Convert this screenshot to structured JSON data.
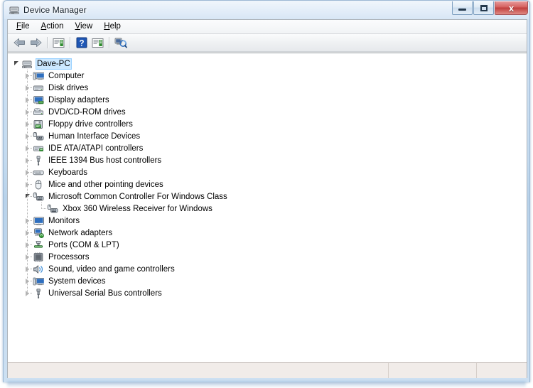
{
  "window": {
    "title": "Device Manager",
    "icon": "device-manager-icon",
    "caption_buttons": {
      "minimize": "minimize-button",
      "maximize": "maximize-button",
      "close_label": "x"
    }
  },
  "menubar": {
    "items": [
      {
        "label": "File",
        "accel": "F",
        "name": "menu-file"
      },
      {
        "label": "Action",
        "accel": "A",
        "name": "menu-action"
      },
      {
        "label": "View",
        "accel": "V",
        "name": "menu-view"
      },
      {
        "label": "Help",
        "accel": "H",
        "name": "menu-help"
      }
    ]
  },
  "toolbar": {
    "buttons": [
      {
        "name": "back-button",
        "icon": "back-arrow-icon",
        "tooltip": "Back"
      },
      {
        "name": "forward-button",
        "icon": "forward-arrow-icon",
        "tooltip": "Forward"
      },
      {
        "name": "separator-1",
        "icon": "separator",
        "tooltip": ""
      },
      {
        "name": "properties-button",
        "icon": "properties-icon",
        "tooltip": "Properties"
      },
      {
        "name": "separator-2",
        "icon": "separator",
        "tooltip": ""
      },
      {
        "name": "help-button",
        "icon": "help-question-icon",
        "tooltip": "Help"
      },
      {
        "name": "show-hidden-button",
        "icon": "show-hidden-devices-icon",
        "tooltip": "Show hidden devices"
      },
      {
        "name": "separator-3",
        "icon": "separator",
        "tooltip": ""
      },
      {
        "name": "scan-hardware-button",
        "icon": "scan-hardware-changes-icon",
        "tooltip": "Scan for hardware changes"
      }
    ]
  },
  "tree": {
    "root": {
      "label": "Dave-PC",
      "icon": "computer-tower-icon",
      "selected": true,
      "expanded": true
    },
    "nodes": [
      {
        "label": "Computer",
        "icon": "computer-icon",
        "expanded": false,
        "level": 1
      },
      {
        "label": "Disk drives",
        "icon": "disk-drive-icon",
        "expanded": false,
        "level": 1
      },
      {
        "label": "Display adapters",
        "icon": "display-adapter-icon",
        "expanded": false,
        "level": 1
      },
      {
        "label": "DVD/CD-ROM drives",
        "icon": "dvd-drive-icon",
        "expanded": false,
        "level": 1
      },
      {
        "label": "Floppy drive controllers",
        "icon": "floppy-controller-icon",
        "expanded": false,
        "level": 1
      },
      {
        "label": "Human Interface Devices",
        "icon": "hid-icon",
        "expanded": false,
        "level": 1
      },
      {
        "label": "IDE ATA/ATAPI controllers",
        "icon": "ide-controller-icon",
        "expanded": false,
        "level": 1
      },
      {
        "label": "IEEE 1394 Bus host controllers",
        "icon": "firewire-icon",
        "expanded": false,
        "level": 1
      },
      {
        "label": "Keyboards",
        "icon": "keyboard-icon",
        "expanded": false,
        "level": 1
      },
      {
        "label": "Mice and other pointing devices",
        "icon": "mouse-icon",
        "expanded": false,
        "level": 1
      },
      {
        "label": "Microsoft Common Controller For Windows Class",
        "icon": "game-controller-icon",
        "expanded": true,
        "level": 1
      },
      {
        "label": "Xbox 360 Wireless Receiver for Windows",
        "icon": "game-controller-icon",
        "expanded": null,
        "level": 2
      },
      {
        "label": "Monitors",
        "icon": "monitor-icon",
        "expanded": false,
        "level": 1
      },
      {
        "label": "Network adapters",
        "icon": "network-adapter-icon",
        "expanded": false,
        "level": 1
      },
      {
        "label": "Ports (COM & LPT)",
        "icon": "port-icon",
        "expanded": false,
        "level": 1
      },
      {
        "label": "Processors",
        "icon": "processor-icon",
        "expanded": false,
        "level": 1
      },
      {
        "label": "Sound, video and game controllers",
        "icon": "sound-icon",
        "expanded": false,
        "level": 1
      },
      {
        "label": "System devices",
        "icon": "system-device-icon",
        "expanded": false,
        "level": 1
      },
      {
        "label": "Universal Serial Bus controllers",
        "icon": "usb-icon",
        "expanded": false,
        "level": 1
      }
    ]
  },
  "statusbar": {
    "pane1": "",
    "pane2": "",
    "pane3": ""
  },
  "colors": {
    "selection": "#cce8ff",
    "selection_border": "#99d1ff",
    "titlebar_start": "#d4e4f5",
    "titlebar_end": "#cde0f2",
    "close_button": "#c03e3c",
    "status_bg": "#f1ece9"
  }
}
